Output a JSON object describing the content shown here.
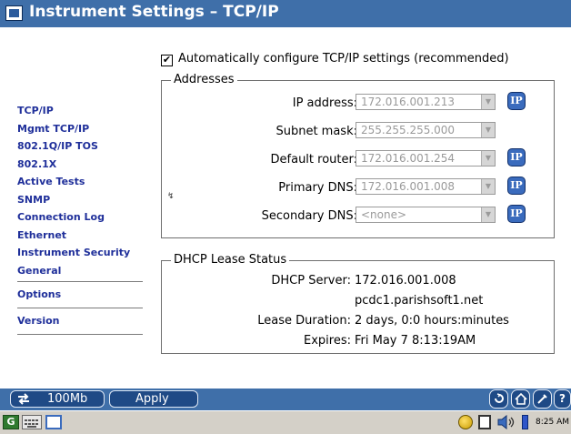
{
  "window": {
    "title": "Instrument Settings – TCP/IP"
  },
  "sidebar": {
    "items": [
      {
        "label": "TCP/IP"
      },
      {
        "label": "Mgmt TCP/IP"
      },
      {
        "label": "802.1Q/IP TOS"
      },
      {
        "label": "802.1X"
      },
      {
        "label": "Active Tests"
      },
      {
        "label": "SNMP"
      },
      {
        "label": "Connection Log"
      },
      {
        "label": "Ethernet"
      },
      {
        "label": "Instrument Security"
      },
      {
        "label": "General"
      }
    ],
    "lower_items": [
      {
        "label": "Options"
      },
      {
        "label": "Version"
      }
    ]
  },
  "auto_config": {
    "label": "Automatically configure TCP/IP settings (recommended)",
    "checked": true,
    "check_mark": "✔"
  },
  "addresses": {
    "legend": "Addresses",
    "fields": [
      {
        "label": "IP address:",
        "value": "172.016.001.213",
        "has_ip_button": true
      },
      {
        "label": "Subnet mask:",
        "value": "255.255.255.000",
        "has_ip_button": false
      },
      {
        "label": "Default router:",
        "value": "172.016.001.254",
        "has_ip_button": true
      },
      {
        "label": "Primary DNS:",
        "value": "172.016.001.008",
        "has_ip_button": true
      },
      {
        "label": "Secondary DNS:",
        "value": "<none>",
        "has_ip_button": true
      }
    ],
    "ip_button_label": "IP"
  },
  "dhcp": {
    "legend": "DHCP Lease Status",
    "server_label": "DHCP Server:",
    "server_value": "172.016.001.008",
    "server_name": "pcdc1.parishsoft1.net",
    "lease_label": "Lease Duration:",
    "lease_value": "2 days, 0:0 hours:minutes",
    "expires_label": "Expires:",
    "expires_value": "Fri May 7  8:13:19AM"
  },
  "bottom_bar": {
    "speed_label": "100Mb",
    "apply_label": "Apply",
    "help_label": "?"
  },
  "taskbar": {
    "clock": "8:25 AM"
  },
  "colors": {
    "titlebar": "#3f6fa9",
    "nav_text": "#1f2f9a",
    "button": "#1f4a86"
  }
}
